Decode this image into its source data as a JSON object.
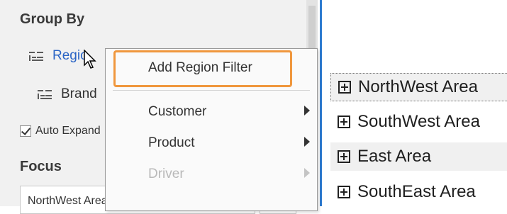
{
  "group_by": {
    "title": "Group By",
    "items": [
      {
        "label": "Regio",
        "icon": "group-lines-icon"
      },
      {
        "label": "Brand",
        "icon": "group-lines-icon"
      }
    ]
  },
  "auto_expand": {
    "label": "Auto Expand",
    "checked": true
  },
  "focus": {
    "title": "Focus",
    "selected": "NorthWest Area",
    "nav_prev": "◂",
    "nav_next": "▸"
  },
  "context_menu": {
    "items": [
      {
        "label": "Add Region Filter",
        "highlighted": true,
        "submenu": false,
        "disabled": false
      },
      {
        "label": "Customer",
        "submenu": true,
        "disabled": false
      },
      {
        "label": "Product",
        "submenu": true,
        "disabled": false
      },
      {
        "label": "Driver",
        "submenu": true,
        "disabled": true
      }
    ],
    "highlight_color": "#f0973d"
  },
  "tree": {
    "rows": [
      {
        "label": "NorthWest Area",
        "icon": "expand-plus-icon"
      },
      {
        "label": "SouthWest Area",
        "icon": "expand-plus-icon"
      },
      {
        "label": "East Area",
        "icon": "expand-plus-icon"
      },
      {
        "label": "SouthEast Area",
        "icon": "expand-plus-icon"
      }
    ]
  },
  "colors": {
    "accent_blue": "#2e7bd0",
    "link_blue": "#2a64c5"
  }
}
